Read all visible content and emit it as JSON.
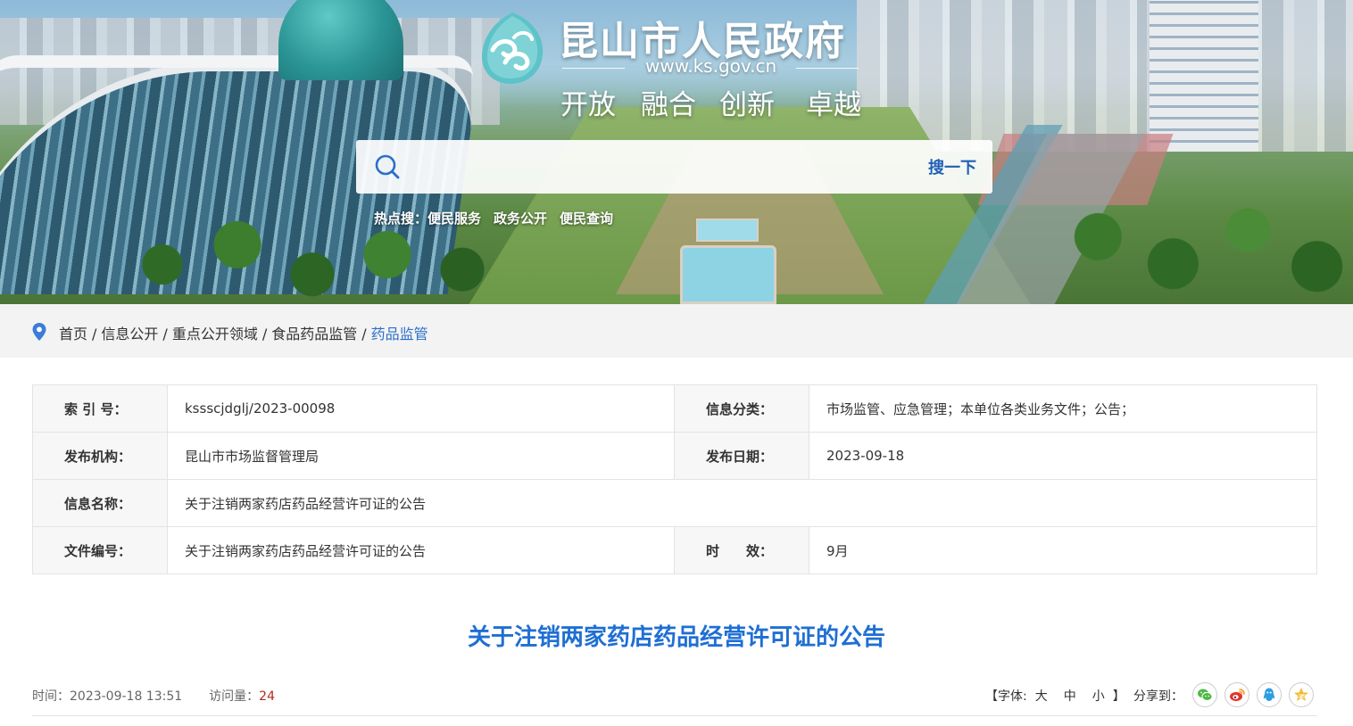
{
  "header": {
    "site_title": "昆山市人民政府",
    "site_url": "www.ks.gov.cn",
    "slogan": [
      "开放",
      "融合",
      "创新",
      "卓越"
    ]
  },
  "search": {
    "placeholder": "",
    "button_label": "搜一下",
    "hot_label": "热点搜：",
    "hot_items": [
      "便民服务",
      "政务公开",
      "便民查询"
    ]
  },
  "breadcrumb": {
    "items": [
      "首页",
      "信息公开",
      "重点公开领域",
      "食品药品监管"
    ],
    "current": "药品监管",
    "separator": "/"
  },
  "info": {
    "index_label": "索 引 号：",
    "index_value": "ksssc​jdglj/2023-00098",
    "category_label": "信息分类：",
    "category_value": "市场监管、应急管理；本单位各类业务文件；公告；",
    "publisher_label": "发布机构：",
    "publisher_value": "昆山市市场监督管理局",
    "date_label": "发布日期：",
    "date_value": "2023-09-18",
    "name_label": "信息名称：",
    "name_value": "关于注销两家药店药品经营许可证的公告",
    "docno_label": "文件编号：",
    "docno_value": "关于注销两家药店药品经营许可证的公告",
    "validity_label": "时　　效：",
    "validity_value": "9月"
  },
  "article": {
    "title": "关于注销两家药店药品经营许可证的公告",
    "time_label": "时间：",
    "time_value": "2023-09-18 13:51",
    "views_label": "访问量：",
    "views_value": "24",
    "font_open": "【字体:",
    "font_large": "大",
    "font_medium": "中",
    "font_small": "小",
    "font_close": "】",
    "share_label": "分享到：",
    "share_icons": [
      "wechat-icon",
      "weibo-icon",
      "qq-icon",
      "qzone-icon"
    ]
  },
  "colors": {
    "accent": "#1f6fd3",
    "breadcrumb_current": "#2a6fc9",
    "views_number": "#b52a1f",
    "search_button": "#1f5fb6"
  }
}
